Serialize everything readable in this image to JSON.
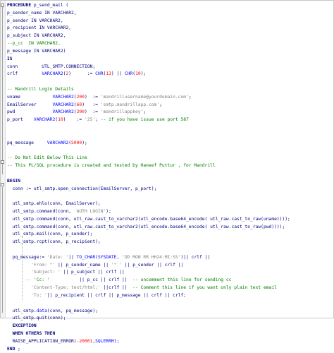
{
  "editor": {
    "lines": [
      [
        {
          "t": "PROCEDURE ",
          "c": "kw"
        },
        {
          "t": "p_send_mail (",
          "c": "id"
        }
      ],
      [
        {
          "t": "p_sender_name IN VARCHAR2,",
          "c": "id"
        }
      ],
      [
        {
          "t": "p_sender IN VARCHAR2,",
          "c": "id"
        }
      ],
      [
        {
          "t": "p_recipient IN VARCHAR2,",
          "c": "id"
        }
      ],
      [
        {
          "t": "p_subject IN VARCHAR2,",
          "c": "id"
        }
      ],
      [
        {
          "t": "--p_cc  IN VARCHAR2,",
          "c": "cm"
        }
      ],
      [
        {
          "t": "p_message IN VARCHAR2)",
          "c": "id"
        }
      ],
      [
        {
          "t": "IS",
          "c": "kw"
        }
      ],
      [
        {
          "t": "conn         ",
          "c": "id"
        },
        {
          "t": "UTL_SMTP.CONNECTION;",
          "c": "id"
        }
      ],
      [
        {
          "t": "crlf         ",
          "c": "id"
        },
        {
          "t": "VARCHAR2",
          "c": "fn"
        },
        {
          "t": "(",
          "c": "id"
        },
        {
          "t": "2",
          "c": "num"
        },
        {
          "t": ")      := ",
          "c": "id"
        },
        {
          "t": "CHR",
          "c": "fn"
        },
        {
          "t": "(",
          "c": "id"
        },
        {
          "t": "13",
          "c": "num"
        },
        {
          "t": ") || ",
          "c": "id"
        },
        {
          "t": "CHR",
          "c": "fn"
        },
        {
          "t": "(",
          "c": "id"
        },
        {
          "t": "10",
          "c": "num"
        },
        {
          "t": ");",
          "c": "id"
        }
      ],
      [
        {
          "t": "",
          "c": "id"
        }
      ],
      [
        {
          "t": "-- Mandrill Login Details",
          "c": "cm"
        }
      ],
      [
        {
          "t": "uname            ",
          "c": "id"
        },
        {
          "t": "VARCHAR2",
          "c": "fn"
        },
        {
          "t": "(",
          "c": "id"
        },
        {
          "t": "200",
          "c": "num"
        },
        {
          "t": ")  := ",
          "c": "id"
        },
        {
          "t": "'mandrillusername@yourdomain.com'",
          "c": "str"
        },
        {
          "t": ";",
          "c": "id"
        }
      ],
      [
        {
          "t": "EmailServer      ",
          "c": "id"
        },
        {
          "t": "VARCHAR2",
          "c": "fn"
        },
        {
          "t": "(",
          "c": "id"
        },
        {
          "t": "60",
          "c": "num"
        },
        {
          "t": ")   := ",
          "c": "id"
        },
        {
          "t": "'smtp.mandrillapp.com'",
          "c": "str"
        },
        {
          "t": ";",
          "c": "id"
        }
      ],
      [
        {
          "t": "pwd              ",
          "c": "id"
        },
        {
          "t": "VARCHAR2",
          "c": "fn"
        },
        {
          "t": "(",
          "c": "id"
        },
        {
          "t": "200",
          "c": "num"
        },
        {
          "t": ")  := ",
          "c": "id"
        },
        {
          "t": "'mandrillappkey'",
          "c": "str"
        },
        {
          "t": ";",
          "c": "id"
        }
      ],
      [
        {
          "t": "p_port    ",
          "c": "id"
        },
        {
          "t": "VARCHAR2",
          "c": "fn"
        },
        {
          "t": "(",
          "c": "id"
        },
        {
          "t": "10",
          "c": "num"
        },
        {
          "t": ")    := ",
          "c": "id"
        },
        {
          "t": "'25'",
          "c": "str"
        },
        {
          "t": "; ",
          "c": "id"
        },
        {
          "t": "-- if you have issue use port 587",
          "c": "cm"
        }
      ],
      [
        {
          "t": "",
          "c": "id"
        }
      ],
      [
        {
          "t": "",
          "c": "id"
        }
      ],
      [
        {
          "t": "pq_message     ",
          "c": "id"
        },
        {
          "t": "VARCHAR2",
          "c": "fn"
        },
        {
          "t": "(",
          "c": "id"
        },
        {
          "t": "5000",
          "c": "num"
        },
        {
          "t": ");",
          "c": "id"
        }
      ],
      [
        {
          "t": "",
          "c": "id"
        }
      ],
      [
        {
          "t": "-- Do Not Edit Below This Line",
          "c": "cm"
        }
      ],
      [
        {
          "t": "-- This PL/SQL procedure is created and tested by Haneef Puttur , for Mandrill",
          "c": "cm"
        }
      ],
      [
        {
          "t": "",
          "c": "id"
        }
      ],
      [
        {
          "t": "BEGIN",
          "c": "kw"
        }
      ],
      [
        {
          "t": "  conn := utl_smtp.open_connection(EmailServer, p_port);",
          "c": "id"
        }
      ],
      [
        {
          "t": "",
          "c": "id"
        }
      ],
      [
        {
          "t": "  utl_smtp.ehlo(conn, EmailServer);",
          "c": "id"
        }
      ],
      [
        {
          "t": "  utl_smtp.command(conn, ",
          "c": "id"
        },
        {
          "t": "'AUTH LOGIN'",
          "c": "str"
        },
        {
          "t": ");",
          "c": "id"
        }
      ],
      [
        {
          "t": "  utl_smtp.command(conn, utl_raw.cast_to_varchar2(utl_encode.base64_encode( utl_raw.cast_to_raw(uname))));",
          "c": "id"
        }
      ],
      [
        {
          "t": "  utl_smtp.command(conn, utl_raw.cast_to_varchar2(utl_encode.base64_encode( utl_raw.cast_to_raw(pwd))));",
          "c": "id"
        }
      ],
      [
        {
          "t": "  utl_smtp.mail(conn, p_sender);",
          "c": "id"
        }
      ],
      [
        {
          "t": "  utl_smtp.rcpt(conn, p_recipient);",
          "c": "id"
        }
      ],
      [
        {
          "t": "",
          "c": "id"
        }
      ],
      [
        {
          "t": "  pq_message:= ",
          "c": "id"
        },
        {
          "t": "'Date: '",
          "c": "str"
        },
        {
          "t": "|| ",
          "c": "id"
        },
        {
          "t": "TO_CHAR",
          "c": "fn"
        },
        {
          "t": "(",
          "c": "id"
        },
        {
          "t": "SYSDATE",
          "c": "fn"
        },
        {
          "t": ", ",
          "c": "id"
        },
        {
          "t": "'DD MON RR HH24:MI:SS'",
          "c": "str"
        },
        {
          "t": ")|| crlf ||",
          "c": "id"
        }
      ],
      [
        {
          "t": "         ",
          "c": "id"
        },
        {
          "t": "'From: \"'",
          "c": "str"
        },
        {
          "t": " || p_sender_name || ",
          "c": "id"
        },
        {
          "t": "'\" '",
          "c": "str"
        },
        {
          "t": " || p_sender || crlf ||",
          "c": "id"
        }
      ],
      [
        {
          "t": "         ",
          "c": "id"
        },
        {
          "t": "'Subject: '",
          "c": "str"
        },
        {
          "t": " || p_subject || crlf ||",
          "c": "id"
        }
      ],
      [
        {
          "t": "       ",
          "c": "id"
        },
        {
          "t": "-- 'Cc: '",
          "c": "cm"
        },
        {
          "t": "           || p_cc || crlf ||  ",
          "c": "id"
        },
        {
          "t": "-- uncomment this line for sending cc",
          "c": "cm"
        }
      ],
      [
        {
          "t": "         ",
          "c": "id"
        },
        {
          "t": "'Content-Type: text/html;'",
          "c": "str"
        },
        {
          "t": " ||crlf ||  ",
          "c": "id"
        },
        {
          "t": "-- Comment this line if you want only plain text email",
          "c": "cm"
        }
      ],
      [
        {
          "t": "         ",
          "c": "id"
        },
        {
          "t": "'To: '",
          "c": "str"
        },
        {
          "t": "|| p_recipient || crlf || p_message || crlf || crlf;",
          "c": "id"
        }
      ],
      [
        {
          "t": "",
          "c": "id"
        }
      ],
      [
        {
          "t": "  utl_smtp.",
          "c": "id"
        },
        {
          "t": "data",
          "c": "fn"
        },
        {
          "t": "(conn, pq_message);",
          "c": "id"
        }
      ],
      [
        {
          "t": "  utl_smtp.quit(conn);",
          "c": "id"
        }
      ],
      [
        {
          "t": "  EXCEPTION",
          "c": "kw"
        }
      ],
      [
        {
          "t": "  WHEN OTHERS THEN",
          "c": "kw"
        }
      ],
      [
        {
          "t": "  RAISE_APPLICATION_ERROR(",
          "c": "id"
        },
        {
          "t": "-20001",
          "c": "num"
        },
        {
          "t": ",",
          "c": "id"
        },
        {
          "t": "SQLERRM",
          "c": "fn"
        },
        {
          "t": ");",
          "c": "id"
        }
      ],
      [
        {
          "t": "END ",
          "c": "kw"
        },
        {
          "t": ";",
          "c": "id"
        }
      ]
    ]
  },
  "colors": {
    "keyword": "#000080",
    "string": "#808080",
    "number": "#ff0000",
    "comment": "#008000",
    "builtin": "#0000ff"
  }
}
